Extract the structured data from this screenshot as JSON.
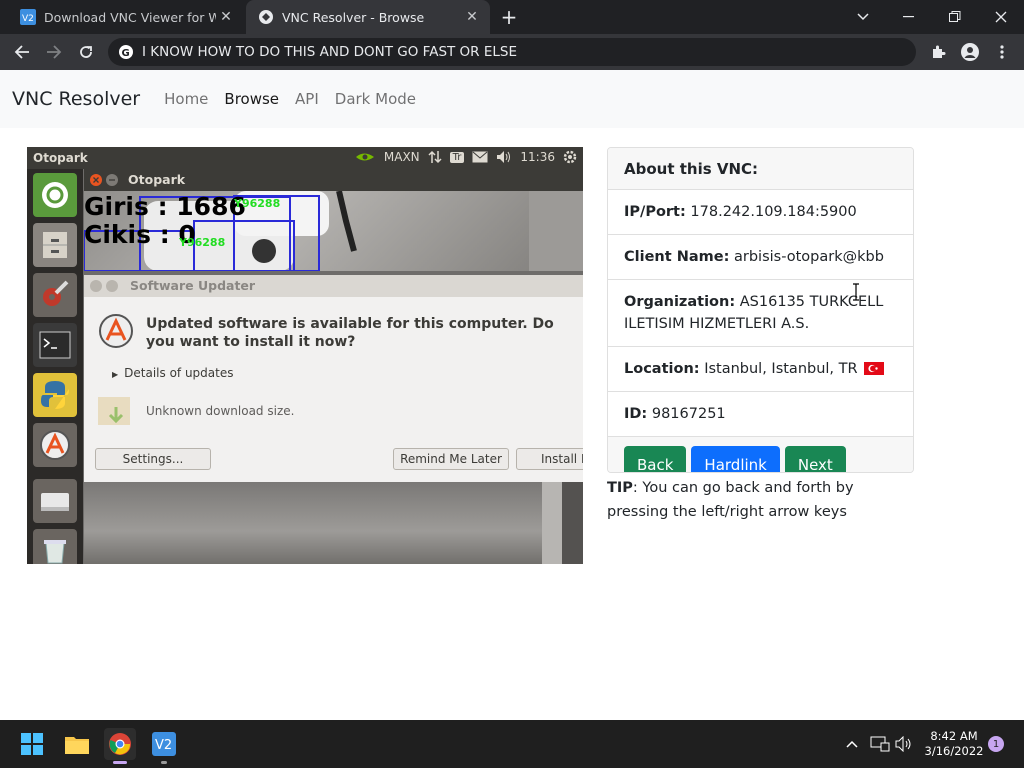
{
  "browser": {
    "tabs": [
      {
        "title": "Download VNC Viewer for Windows",
        "active": false
      },
      {
        "title": "VNC Resolver - Browse",
        "active": true
      }
    ],
    "address_bar": "I KNOW HOW TO DO THIS AND DONT GO FAST OR ELSE",
    "favicon_text": "V2"
  },
  "site": {
    "brand": "VNC Resolver",
    "nav": [
      "Home",
      "Browse",
      "API",
      "Dark Mode"
    ],
    "active_nav": "Browse"
  },
  "screenshot": {
    "topbar_title": "Otopark",
    "topbar_right": {
      "gpu": "MAXN",
      "time": "11:36",
      "tr_badge": "Tr"
    },
    "camera_window_title": "Otopark",
    "overlay_line1": "Giris : 1686",
    "overlay_line2": "Cikis : 0",
    "plate_label_1": "Y96288",
    "plate_label_2": "Y96288",
    "updater": {
      "title": "Software Updater",
      "heading": "Updated software is available for this computer. Do you want to install it now?",
      "details": "Details of updates",
      "size": "Unknown download size.",
      "buttons": [
        "Settings...",
        "Remind Me Later",
        "Install Now"
      ]
    }
  },
  "info": {
    "header": "About this VNC:",
    "rows": [
      {
        "label": "IP/Port:",
        "value": "178.242.109.184:5900"
      },
      {
        "label": "Client Name:",
        "value": "arbisis-otopark@kbb"
      },
      {
        "label": "Organization:",
        "value": "AS16135 TURKCELL ILETISIM HIZMETLERI A.S."
      },
      {
        "label": "Location:",
        "value": "Istanbul, Istanbul, TR"
      },
      {
        "label": "ID:",
        "value": "98167251"
      }
    ],
    "buttons": {
      "back": "Back",
      "hardlink": "Hardlink",
      "next": "Next"
    },
    "flag_color": "#e30a17"
  },
  "tip": {
    "label": "TIP",
    "text": ": You can go back and forth by pressing the left/right arrow keys"
  },
  "taskbar": {
    "time": "8:42 AM",
    "date": "3/16/2022",
    "notification_count": "1"
  }
}
